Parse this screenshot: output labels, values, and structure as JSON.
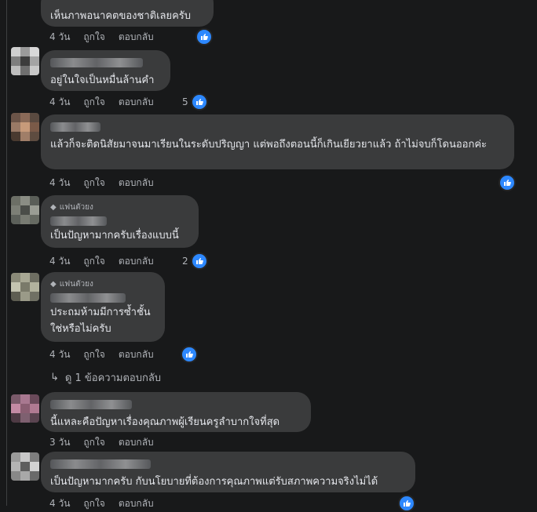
{
  "comments": [
    {
      "text": "เห็นภาพอนาคตของชาติเลยครับ",
      "time": "4 วัน",
      "like_label": "ถูกใจ",
      "reply_label": "ตอบกลับ",
      "reaction_count": ""
    },
    {
      "text": "อยู่ในใจเป็นหมื่นล้านคำ",
      "time": "4 วัน",
      "like_label": "ถูกใจ",
      "reply_label": "ตอบกลับ",
      "reaction_count": "5"
    },
    {
      "text": "แล้วก็จะติดนิสัยมาจนมาเรียนในระดับปริญญา แต่พอถึงตอนนี้ก็เกินเยียวยาแล้ว ถ้าไม่จบก็โดนออกค่ะ",
      "time": "4 วัน",
      "like_label": "ถูกใจ",
      "reply_label": "ตอบกลับ",
      "reaction_count": ""
    },
    {
      "badge": "แฟนตัวยง",
      "text": "เป็นปัญหามากครับเรื่องแบบนี้",
      "time": "4 วัน",
      "like_label": "ถูกใจ",
      "reply_label": "ตอบกลับ",
      "reaction_count": "2"
    },
    {
      "badge": "แฟนตัวยง",
      "text": "ประถมห้ามมีการซ้ำชั้น ใช่หรือไม่ครับ",
      "time": "4 วัน",
      "like_label": "ถูกใจ",
      "reply_label": "ตอบกลับ",
      "reaction_count": ""
    },
    {
      "text": "นี้แหละคือปัญหาเรื่องคุณภาพผู้เรียนครูลำบากใจที่สุด",
      "time": "3 วัน",
      "like_label": "ถูกใจ",
      "reply_label": "ตอบกลับ",
      "reaction_count": ""
    },
    {
      "text": "เป็นปัญหามากครับ กับนโยบายที่ต้องการคุณภาพแต่รับสภาพความจริงไม่ได้",
      "time": "4 วัน",
      "like_label": "ถูกใจ",
      "reply_label": "ตอบกลับ",
      "reaction_count": ""
    }
  ],
  "view_more_replies": "ดู 1 ข้อความตอบกลับ",
  "colors": {
    "background": "#18191a",
    "bubble": "#3a3b3c",
    "like": "#2d88ff",
    "text": "#e4e6eb",
    "muted": "#b0b3b8"
  },
  "icons": {
    "reaction": "like-thumb-icon",
    "reply_arrow": "reply-arrow-icon",
    "badge": "diamond-icon"
  }
}
